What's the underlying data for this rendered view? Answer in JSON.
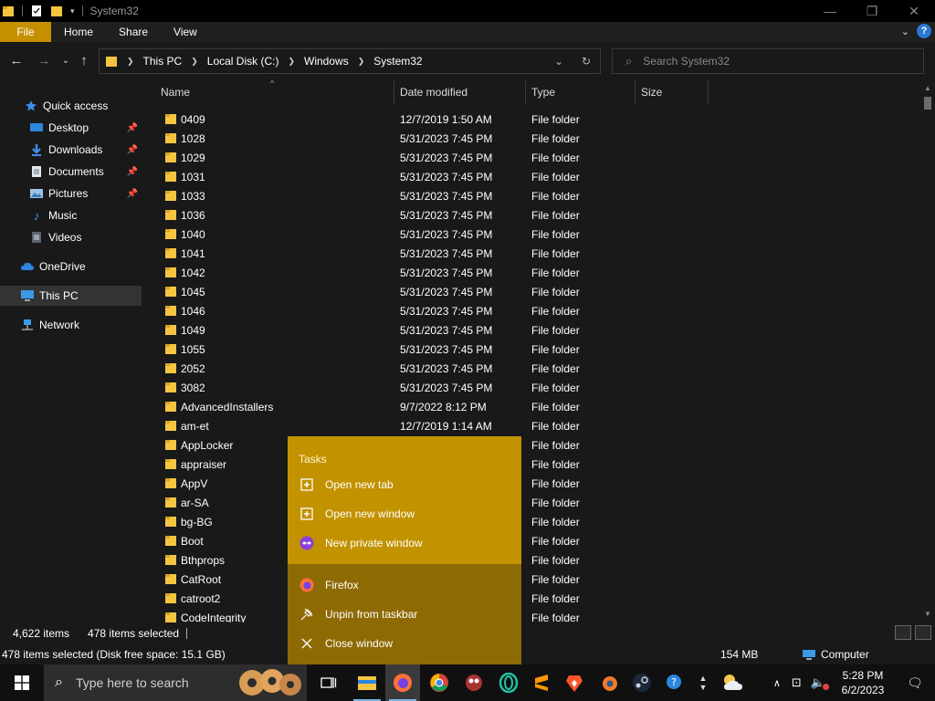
{
  "window": {
    "title": "System32",
    "controls": {
      "minimize": "—",
      "maximize": "❐",
      "close": "✕"
    }
  },
  "ribbon": {
    "tabs": [
      "File",
      "Home",
      "Share",
      "View"
    ]
  },
  "address": {
    "path": [
      "This PC",
      "Local Disk (C:)",
      "Windows",
      "System32"
    ]
  },
  "search": {
    "placeholder": "Search System32"
  },
  "sidebar": {
    "items": [
      {
        "label": "Quick access",
        "icon": "star-icon",
        "pinned": false
      },
      {
        "label": "Desktop",
        "icon": "desktop-icon",
        "pinned": true
      },
      {
        "label": "Downloads",
        "icon": "download-icon",
        "pinned": true
      },
      {
        "label": "Documents",
        "icon": "document-icon",
        "pinned": true
      },
      {
        "label": "Pictures",
        "icon": "picture-icon",
        "pinned": true
      },
      {
        "label": "Music",
        "icon": "music-icon",
        "pinned": false
      },
      {
        "label": "Videos",
        "icon": "video-icon",
        "pinned": false
      },
      {
        "label": "OneDrive",
        "icon": "cloud-icon",
        "pinned": false
      },
      {
        "label": "This PC",
        "icon": "computer-icon",
        "pinned": false
      },
      {
        "label": "Network",
        "icon": "network-icon",
        "pinned": false
      }
    ]
  },
  "columns": {
    "name": "Name",
    "date": "Date modified",
    "type": "Type",
    "size": "Size"
  },
  "files": [
    {
      "name": "0409",
      "date": "12/7/2019 1:50 AM",
      "type": "File folder"
    },
    {
      "name": "1028",
      "date": "5/31/2023 7:45 PM",
      "type": "File folder"
    },
    {
      "name": "1029",
      "date": "5/31/2023 7:45 PM",
      "type": "File folder"
    },
    {
      "name": "1031",
      "date": "5/31/2023 7:45 PM",
      "type": "File folder"
    },
    {
      "name": "1033",
      "date": "5/31/2023 7:45 PM",
      "type": "File folder"
    },
    {
      "name": "1036",
      "date": "5/31/2023 7:45 PM",
      "type": "File folder"
    },
    {
      "name": "1040",
      "date": "5/31/2023 7:45 PM",
      "type": "File folder"
    },
    {
      "name": "1041",
      "date": "5/31/2023 7:45 PM",
      "type": "File folder"
    },
    {
      "name": "1042",
      "date": "5/31/2023 7:45 PM",
      "type": "File folder"
    },
    {
      "name": "1045",
      "date": "5/31/2023 7:45 PM",
      "type": "File folder"
    },
    {
      "name": "1046",
      "date": "5/31/2023 7:45 PM",
      "type": "File folder"
    },
    {
      "name": "1049",
      "date": "5/31/2023 7:45 PM",
      "type": "File folder"
    },
    {
      "name": "1055",
      "date": "5/31/2023 7:45 PM",
      "type": "File folder"
    },
    {
      "name": "2052",
      "date": "5/31/2023 7:45 PM",
      "type": "File folder"
    },
    {
      "name": "3082",
      "date": "5/31/2023 7:45 PM",
      "type": "File folder"
    },
    {
      "name": "AdvancedInstallers",
      "date": "9/7/2022 8:12 PM",
      "type": "File folder"
    },
    {
      "name": "am-et",
      "date": "12/7/2019 1:14 AM",
      "type": "File folder"
    },
    {
      "name": "AppLocker",
      "date": "",
      "type": "File folder"
    },
    {
      "name": "appraiser",
      "date": "",
      "type": "File folder"
    },
    {
      "name": "AppV",
      "date": "",
      "type": "File folder"
    },
    {
      "name": "ar-SA",
      "date": "",
      "type": "File folder"
    },
    {
      "name": "bg-BG",
      "date": "",
      "type": "File folder"
    },
    {
      "name": "Boot",
      "date": "",
      "type": "File folder"
    },
    {
      "name": "Bthprops",
      "date": "",
      "type": "File folder"
    },
    {
      "name": "CatRoot",
      "date": "",
      "type": "File folder"
    },
    {
      "name": "catroot2",
      "date": "",
      "type": "File folder"
    },
    {
      "name": "CodeIntegrity",
      "date": "",
      "type": "File folder"
    }
  ],
  "status": {
    "count": "4,622 items",
    "selected": "478 items selected"
  },
  "details": {
    "selection": "478 items selected (Disk free space: 15.1 GB)",
    "size": "154 MB",
    "location": "Computer"
  },
  "jumplist": {
    "heading": "Tasks",
    "tasks": [
      {
        "label": "Open new tab",
        "icon": "new-tab-icon"
      },
      {
        "label": "Open new window",
        "icon": "new-window-icon"
      },
      {
        "label": "New private window",
        "icon": "private-mask-icon"
      }
    ],
    "actions": [
      {
        "label": "Firefox",
        "icon": "firefox-icon"
      },
      {
        "label": "Unpin from taskbar",
        "icon": "unpin-icon"
      },
      {
        "label": "Close window",
        "icon": "close-icon"
      }
    ]
  },
  "taskbar": {
    "search_placeholder": "Type here to search",
    "time": "5:28 PM",
    "date": "6/2/2023"
  },
  "colors": {
    "accent": "#c49000",
    "jumplist_top": "#c29200",
    "jumplist_bottom": "#8e6a05",
    "folder": "#f5c542",
    "background": "#191919"
  }
}
